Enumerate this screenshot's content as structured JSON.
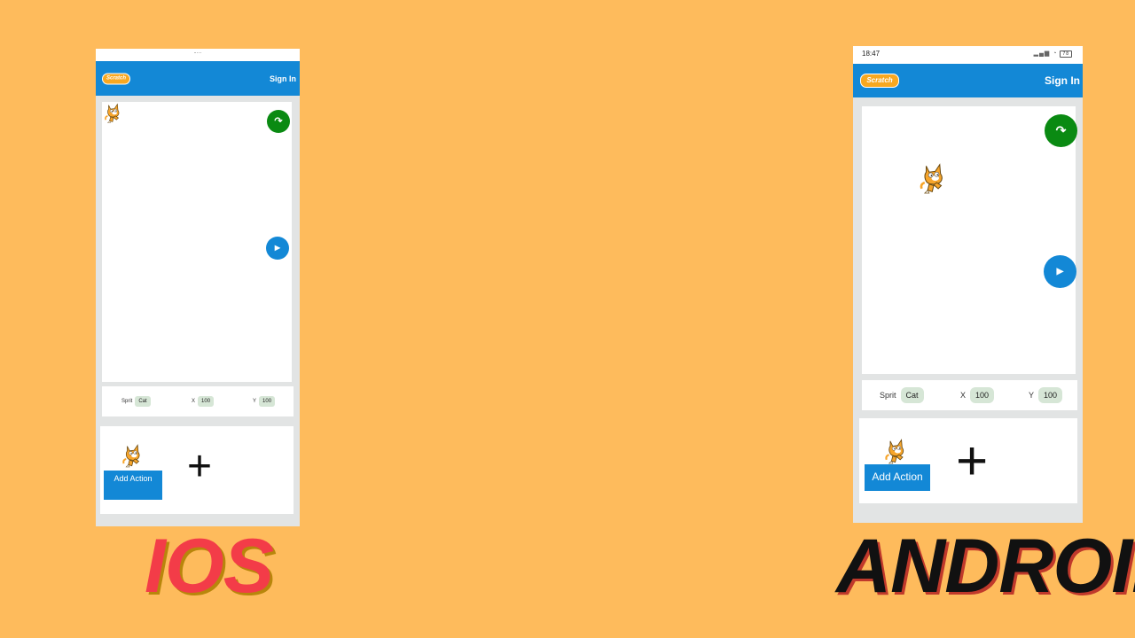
{
  "brand": {
    "logo_text": "Scratch",
    "sign_in": "Sign In"
  },
  "ios": {
    "caption": "IOS",
    "sprite_label": "Sprit",
    "sprite_value": "Cat",
    "x_label": "X",
    "x_value": "100",
    "y_label": "Y",
    "y_value": "100",
    "add_action": "Add Action"
  },
  "android": {
    "caption": "ANDROID",
    "time": "18:47",
    "battery": "78",
    "sprite_label": "Sprit",
    "sprite_value": "Cat",
    "x_label": "X",
    "x_value": "100",
    "y_label": "Y",
    "y_value": "100",
    "add_action": "Add Action"
  },
  "icons": [
    "green-flag-icon",
    "play-icon",
    "cat-sprite-icon",
    "plus-icon"
  ],
  "colors": {
    "background": "#FEBB5C",
    "header": "#1388D6",
    "flag": "#0A8A12",
    "play": "#1388D6",
    "ios_caption": "#F33C48",
    "android_caption": "#111111"
  }
}
